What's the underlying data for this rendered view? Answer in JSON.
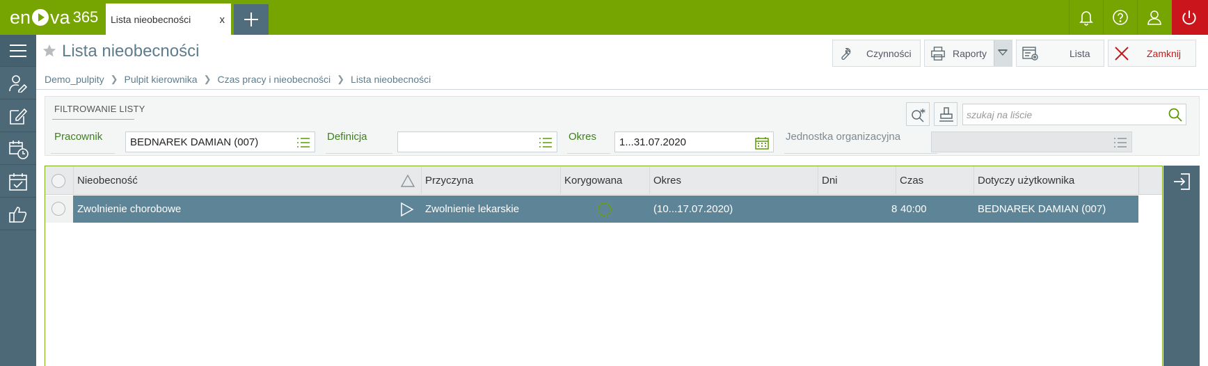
{
  "app": {
    "logo_text_left": "en",
    "logo_text_right": "va",
    "logo_number": "365",
    "accent": "#76a400",
    "sidebar_color": "#4d6876",
    "danger": "#c9151b"
  },
  "tabs": [
    {
      "label": "Lista nieobecności",
      "close": "x",
      "active": true
    }
  ],
  "topbar_icons": [
    "bell-icon",
    "help-icon",
    "user-icon",
    "power-icon"
  ],
  "sidebar": {
    "items": [
      "menu-icon",
      "user-edit-icon",
      "edit-icon",
      "calendar-clock-icon",
      "calendar-check-icon",
      "thumbs-up-icon"
    ]
  },
  "page": {
    "title": "Lista nieobecności"
  },
  "toolbar": {
    "czynnosci": "Czynności",
    "raporty": "Raporty",
    "lista": "Lista",
    "zamknij": "Zamknij"
  },
  "breadcrumb": [
    "Demo_pulpity",
    "Pulpit kierownika",
    "Czas pracy i nieobecności",
    "Lista nieobecności"
  ],
  "filter": {
    "title": "FILTROWANIE LISTY",
    "pracownik_label": "Pracownik",
    "pracownik_value": "BEDNAREK DAMIAN (007)",
    "definicja_label": "Definicja",
    "definicja_value": "",
    "okres_label": "Okres",
    "okres_value": "1...31.07.2020",
    "jednostka_label": "Jednostka organizacyjna",
    "jednostka_value": "",
    "search_placeholder": "szukaj na liście"
  },
  "grid": {
    "columns": [
      "Nieobecność",
      "Przyczyna",
      "Korygowana",
      "Okres",
      "Dni",
      "Czas",
      "Dotyczy użytkownika"
    ],
    "rows": [
      {
        "nieobecnosc": "Zwolnienie chorobowe",
        "przyczyna": "Zwolnienie lekarskie",
        "korygowana": false,
        "okres": "(10...17.07.2020)",
        "dni": "8",
        "czas": "40:00",
        "uzytkownik": "BEDNAREK DAMIAN (007)"
      }
    ],
    "selected_row_color": "#5e8497"
  }
}
